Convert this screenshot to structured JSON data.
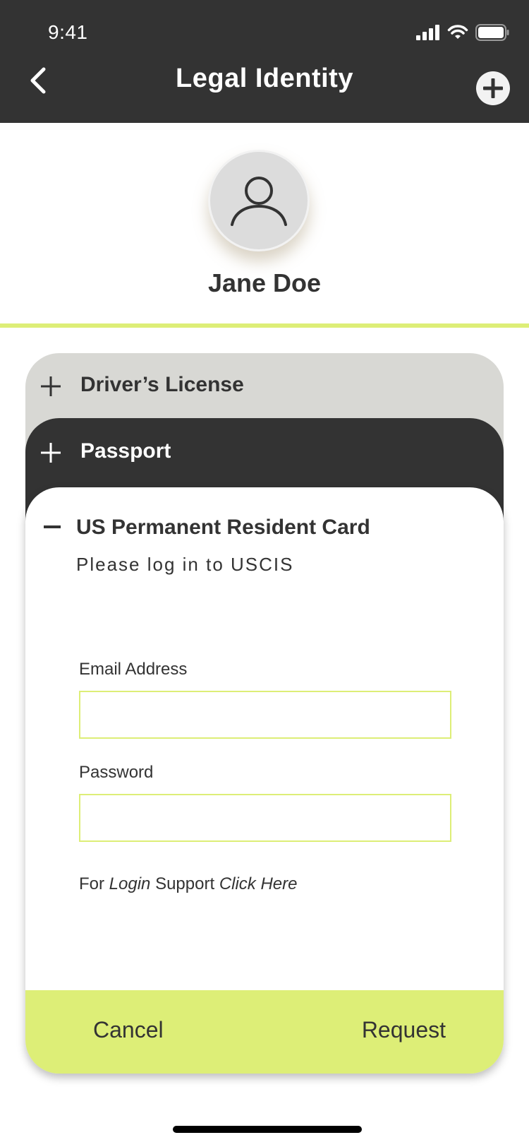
{
  "status_bar": {
    "time": "9:41"
  },
  "header": {
    "title": "Legal Identity"
  },
  "profile": {
    "name": "Jane Doe"
  },
  "documents": {
    "drivers_license": "Driver’s License",
    "passport": "Passport",
    "resident_card": {
      "title": "US Permanent Resident Card",
      "subtitle": "Please log in to USCIS",
      "email_label": "Email Address",
      "email_value": "",
      "password_label": "Password",
      "password_value": "",
      "support": {
        "prefix": "For ",
        "login": "Login",
        "middle": " Support ",
        "link": "Click Here"
      }
    }
  },
  "actions": {
    "cancel": "Cancel",
    "request": "Request"
  },
  "colors": {
    "dark": "#333333",
    "accent": "#ddee77",
    "card_grey": "#d8d8d4",
    "avatar": "#dcdcdc"
  },
  "icons": [
    "back-chevron-icon",
    "add-circle-icon",
    "user-icon",
    "plus-icon",
    "minus-icon",
    "signal-icon",
    "wifi-icon",
    "battery-icon"
  ]
}
